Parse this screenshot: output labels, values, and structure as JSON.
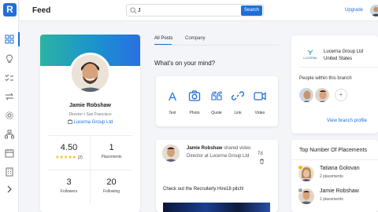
{
  "app": {
    "logo_letter": "R",
    "accent": "#1e6fd9"
  },
  "sidebar": {
    "items": [
      {
        "icon": "dashboard-icon",
        "active": true
      },
      {
        "icon": "lightbulb-icon",
        "active": false
      },
      {
        "icon": "checklist-icon",
        "active": false
      },
      {
        "icon": "swap-arrows-icon",
        "active": false
      },
      {
        "icon": "gear-icon",
        "active": false
      },
      {
        "icon": "org-chart-icon",
        "active": false
      },
      {
        "icon": "calendar-icon",
        "active": false
      },
      {
        "icon": "building-icon",
        "active": false
      },
      {
        "icon": "chevron-right-icon",
        "active": false
      }
    ]
  },
  "header": {
    "title": "Feed",
    "search_value": "J",
    "search_button": "Search",
    "upgrade": "Upgrade"
  },
  "profile": {
    "name": "Jamie Robshaw",
    "role": "Director • San Francisco",
    "company": "Lucerna Group Ltd",
    "rating": "4.50",
    "rating_stars": "★★★★★",
    "rating_count": "(2)",
    "placements_value": "1",
    "placements_label": "Placements",
    "followers_value": "3",
    "followers_label": "Followers",
    "following_value": "20",
    "following_label": "Following"
  },
  "tabs": [
    {
      "label": "All Posts",
      "active": true
    },
    {
      "label": "Company",
      "active": false
    }
  ],
  "composer": {
    "prompt": "What's on your mind?",
    "options": [
      {
        "label": "Text",
        "icon": "text-icon"
      },
      {
        "label": "Photo",
        "icon": "camera-icon"
      },
      {
        "label": "Quote",
        "icon": "quote-icon"
      },
      {
        "label": "Link",
        "icon": "link-icon"
      },
      {
        "label": "Video",
        "icon": "video-icon"
      }
    ]
  },
  "post": {
    "author": "Jamie Robshaw",
    "action": "shared video",
    "subtitle": "Director at Lucerna Group Ltd",
    "time": "7d",
    "text": "Check out the Recruiterly Hire18 pitch!"
  },
  "company_card": {
    "logo_text": "LUCERNA",
    "name": "Lucerna Group Ltd",
    "country": "United States",
    "people_title": "People within this branch",
    "add_label": "+",
    "view_branch": "View branch profile"
  },
  "placements": {
    "title": "Top Number Of Placements",
    "rows": [
      {
        "name": "Tatiana Golovan",
        "count": "2 placements",
        "badge_color": "#f3b91b"
      },
      {
        "name": "Jamie Robshaw",
        "count": "1 placements",
        "badge_color": "#9aa3ad"
      }
    ]
  }
}
